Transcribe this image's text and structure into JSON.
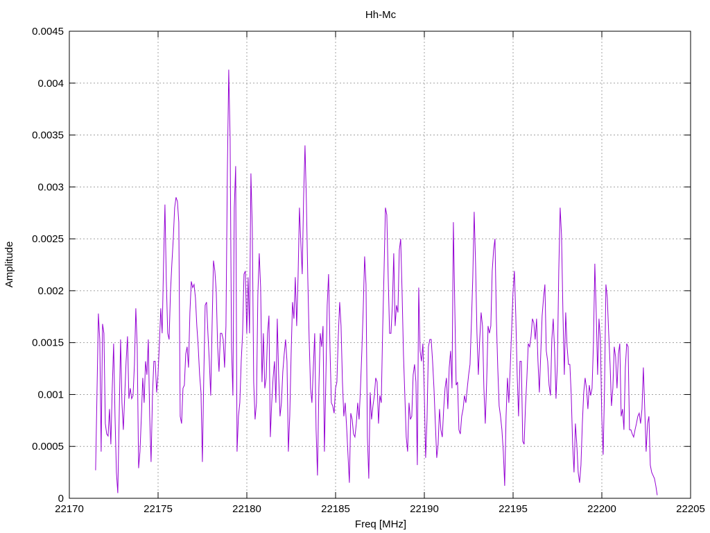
{
  "chart_data": {
    "type": "line",
    "title": "Hh-Mc",
    "xlabel": "Freq [MHz]",
    "ylabel": "Amplitude",
    "xlim": [
      22170,
      22205
    ],
    "ylim": [
      0,
      0.0045
    ],
    "xticks": [
      "22170",
      "22175",
      "22180",
      "22185",
      "22190",
      "22195",
      "22200",
      "22205"
    ],
    "yticks": [
      "0",
      "0.0005",
      "0.001",
      "0.0015",
      "0.002",
      "0.0025",
      "0.003",
      "0.0035",
      "0.004",
      "0.0045"
    ],
    "grid": true,
    "legend": "none",
    "series": [
      {
        "name": "Hh-Mc",
        "color": "#9400d3",
        "x_start": 22171.48,
        "x_step": 0.078125,
        "values": [
          0.00027,
          0.00102,
          0.00178,
          0.00153,
          0.00045,
          0.00168,
          0.00159,
          0.00072,
          0.00062,
          0.0006,
          0.00086,
          0.00052,
          0.00106,
          0.00149,
          0.00079,
          0.00025,
          5e-05,
          0.00079,
          0.00153,
          0.00092,
          0.00066,
          0.00099,
          0.00132,
          0.00156,
          0.00096,
          0.00106,
          0.00096,
          0.00099,
          0.00129,
          0.00183,
          0.00146,
          0.00029,
          0.00045,
          0.00079,
          0.00116,
          0.00092,
          0.00132,
          0.00119,
          0.00153,
          0.00079,
          0.00035,
          0.00099,
          0.00132,
          0.00132,
          0.00102,
          0.00119,
          0.00149,
          0.00183,
          0.00159,
          0.00226,
          0.00283,
          0.00209,
          0.00159,
          0.00153,
          0.00199,
          0.00226,
          0.0025,
          0.0028,
          0.0029,
          0.00286,
          0.00266,
          0.00079,
          0.00072,
          0.00106,
          0.00109,
          0.00139,
          0.00146,
          0.00126,
          0.00179,
          0.00209,
          0.00203,
          0.00206,
          0.00193,
          0.00166,
          0.00146,
          0.00119,
          0.00102,
          0.00035,
          0.00116,
          0.00186,
          0.00189,
          0.00159,
          0.00132,
          0.00099,
          0.00166,
          0.00229,
          0.00219,
          0.00199,
          0.00146,
          0.00122,
          0.00159,
          0.00159,
          0.00153,
          0.00126,
          0.00166,
          0.00313,
          0.00413,
          0.00347,
          0.00146,
          0.00099,
          0.0028,
          0.0032,
          0.00045,
          0.00079,
          0.00092,
          0.00132,
          0.00159,
          0.00216,
          0.00219,
          0.00159,
          0.00213,
          0.00159,
          0.00313,
          0.0026,
          0.00112,
          0.00076,
          0.00092,
          0.00196,
          0.00236,
          0.00203,
          0.00112,
          0.00159,
          0.00106,
          0.00116,
          0.00159,
          0.00176,
          0.00059,
          0.00092,
          0.00116,
          0.00132,
          0.00092,
          0.00173,
          0.00119,
          0.00079,
          0.00092,
          0.00122,
          0.00139,
          0.00153,
          0.00132,
          0.00045,
          0.00079,
          0.00139,
          0.00189,
          0.00173,
          0.00213,
          0.00166,
          0.00213,
          0.0028,
          0.00246,
          0.00216,
          0.0029,
          0.0034,
          0.00286,
          0.00213,
          0.00153,
          0.00106,
          0.00092,
          0.00126,
          0.00159,
          0.00066,
          0.00022,
          0.00106,
          0.00159,
          0.00146,
          0.00166,
          0.00045,
          0.00112,
          0.00186,
          0.00216,
          0.00146,
          0.00092,
          0.00089,
          0.00082,
          0.00106,
          0.00112,
          0.00156,
          0.00189,
          0.00166,
          0.00112,
          0.00079,
          0.00092,
          0.00069,
          0.00042,
          0.00015,
          0.00082,
          0.00076,
          0.00062,
          0.00059,
          0.00072,
          0.00092,
          0.00076,
          0.00106,
          0.00142,
          0.00183,
          0.00233,
          0.00206,
          0.00059,
          0.00019,
          0.00102,
          0.00076,
          0.00089,
          0.00099,
          0.00116,
          0.00112,
          0.00072,
          0.00099,
          0.00092,
          0.00162,
          0.00219,
          0.0028,
          0.00273,
          0.00213,
          0.00159,
          0.00159,
          0.00186,
          0.00236,
          0.00166,
          0.00186,
          0.00179,
          0.00239,
          0.0025,
          0.00199,
          0.00139,
          0.00099,
          0.00059,
          0.00045,
          0.00092,
          0.00076,
          0.00079,
          0.00119,
          0.00129,
          0.00112,
          0.00032,
          0.00203,
          0.00142,
          0.00132,
          0.00149,
          0.00102,
          0.00039,
          0.00076,
          0.00146,
          0.00153,
          0.00153,
          0.00132,
          0.00106,
          0.00072,
          0.00039,
          0.00052,
          0.00086,
          0.00066,
          0.00059,
          0.00086,
          0.00106,
          0.00116,
          0.00086,
          0.00126,
          0.00142,
          0.00106,
          0.00266,
          0.00186,
          0.00109,
          0.00112,
          0.00066,
          0.00062,
          0.00079,
          0.00086,
          0.00099,
          0.00092,
          0.00106,
          0.00119,
          0.00129,
          0.00169,
          0.00213,
          0.00276,
          0.00226,
          0.00159,
          0.00119,
          0.00153,
          0.00179,
          0.00166,
          0.00106,
          0.00072,
          0.00112,
          0.00166,
          0.00159,
          0.00166,
          0.00219,
          0.00239,
          0.0025,
          0.00173,
          0.00126,
          0.00089,
          0.00079,
          0.00066,
          0.00045,
          0.00012,
          0.00079,
          0.00116,
          0.00092,
          0.00126,
          0.00162,
          0.00199,
          0.00219,
          0.00176,
          0.00119,
          0.00079,
          0.00132,
          0.00132,
          0.00055,
          0.00052,
          0.00089,
          0.00116,
          0.00149,
          0.00146,
          0.00156,
          0.00173,
          0.00169,
          0.00153,
          0.00173,
          0.00132,
          0.00102,
          0.00139,
          0.00176,
          0.00193,
          0.00206,
          0.00142,
          0.00132,
          0.00109,
          0.00099,
          0.00153,
          0.00173,
          0.00142,
          0.00096,
          0.00129,
          0.00219,
          0.0028,
          0.00253,
          0.00179,
          0.00119,
          0.00179,
          0.00146,
          0.00129,
          0.00129,
          0.00099,
          0.00052,
          0.00025,
          0.00072,
          0.00052,
          0.00025,
          0.00015,
          0.00032,
          0.00072,
          0.00102,
          0.00116,
          0.00106,
          0.00086,
          0.00109,
          0.00099,
          0.00106,
          0.00149,
          0.00226,
          0.00179,
          0.00119,
          0.00173,
          0.00153,
          0.00079,
          0.00042,
          0.00106,
          0.00206,
          0.00193,
          0.00159,
          0.00129,
          0.00089,
          0.00106,
          0.00146,
          0.00136,
          0.00106,
          0.00139,
          0.00149,
          0.00079,
          0.00086,
          0.00066,
          0.00126,
          0.00149,
          0.00146,
          0.00066,
          0.00066,
          0.00062,
          0.00059,
          0.00066,
          0.00072,
          0.00079,
          0.00082,
          0.00072,
          0.00086,
          0.00126,
          0.00086,
          0.00045,
          0.00072,
          0.00079,
          0.00032,
          0.00025,
          0.00022,
          0.00019,
          0.00012,
          3e-05
        ]
      }
    ]
  }
}
